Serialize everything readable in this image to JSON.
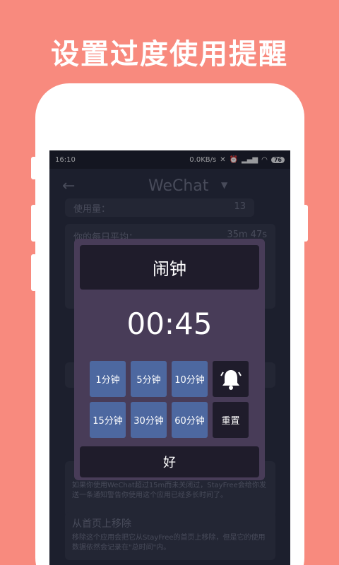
{
  "headline": "设置过度使用提醒",
  "status_bar": {
    "time": "16:10",
    "net_speed": "0.0KB/s",
    "battery": "76"
  },
  "app_bar": {
    "title": "WeChat",
    "back_icon": "arrow-left-icon",
    "dropdown_icon": "caret-down-icon"
  },
  "background": {
    "usage_label": "使用量：",
    "usage_value": "13",
    "daily_avg_label": "你的每日平均：",
    "daily_avg_value": "35m 47s",
    "notify_desc": "如果你使用WeChat超过15m而未关闭过，StayFree会给你发送一条通知警告你使用这个应用已经多长时间了。",
    "remove_title": "从首页上移除",
    "remove_desc": "移除这个应用会把它从StayFree的首页上移除，但是它的使用数据依然会记录在\"总时间\"内。"
  },
  "dialog": {
    "title": "闹钟",
    "timer": "00:45",
    "presets": [
      "1分钟",
      "5分钟",
      "10分钟",
      "15分钟",
      "30分钟",
      "60分钟"
    ],
    "bell_icon": "bell-icon",
    "reset_label": "重置",
    "ok_label": "好"
  },
  "colors": {
    "page_bg": "#f88a7e",
    "screen_bg": "#272a3b",
    "dialog_bg": "#483c58",
    "chip_blue": "#4d68a0",
    "dark_button": "#1f1c2b"
  }
}
